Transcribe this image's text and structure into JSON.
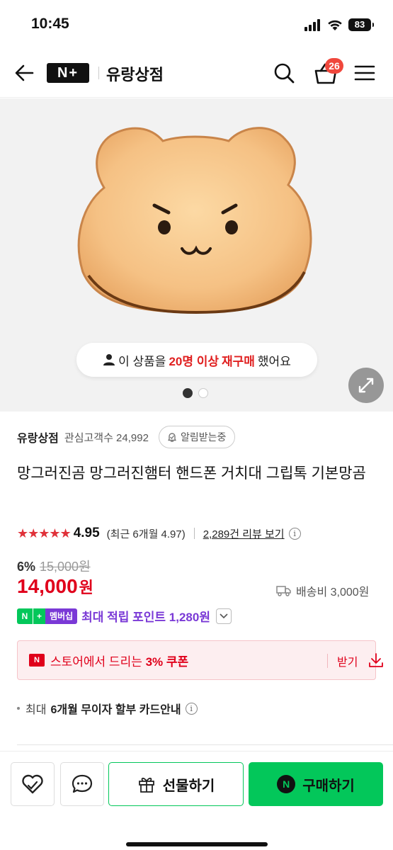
{
  "status": {
    "time": "10:45",
    "battery": "83"
  },
  "header": {
    "logo": "N+",
    "store_name": "유랑상점",
    "cart_count": "26"
  },
  "hero": {
    "rebuy_prefix": "이 상품을",
    "rebuy_highlight1": "20명 이상",
    "rebuy_highlight2": "재구매",
    "rebuy_suffix": "했어요",
    "image_count": 2,
    "active_image": 1
  },
  "store": {
    "name": "유랑상점",
    "fans": "관심고객수 24,992",
    "alarm_label": "알림받는중"
  },
  "product": {
    "title": "망그러진곰 망그러진햄터 핸드폰 거치대 그립톡 기본망곰",
    "stars": "★★★★★",
    "rating": "4.95",
    "recent_rating": "(최근 6개월 4.97)",
    "reviews": "2,289건 리뷰 보기",
    "discount": "6%",
    "original_price": "15,000원",
    "price": "14,000",
    "currency": "원",
    "shipping": "배송비 3,000원"
  },
  "points": {
    "badge_n": "N",
    "badge_plus": "+",
    "badge_label": "멤버십",
    "text": "최대 적립 포인트 1,280원"
  },
  "coupon": {
    "logo": "N",
    "text_prefix": "스토어에서 드리는 ",
    "text_bold": "3% 쿠폰",
    "get_label": "받기"
  },
  "card_info": {
    "prefix": "최대",
    "bold": "6개월 무이자 할부 카드안내"
  },
  "bottom": {
    "gift_label": "선물하기",
    "buy_label": "구매하기",
    "buy_icon": "N"
  },
  "colors": {
    "naver_green": "#03c75a",
    "price_red": "#e0001b",
    "membership_purple": "#7a39d6",
    "star_red": "#e0323a"
  }
}
